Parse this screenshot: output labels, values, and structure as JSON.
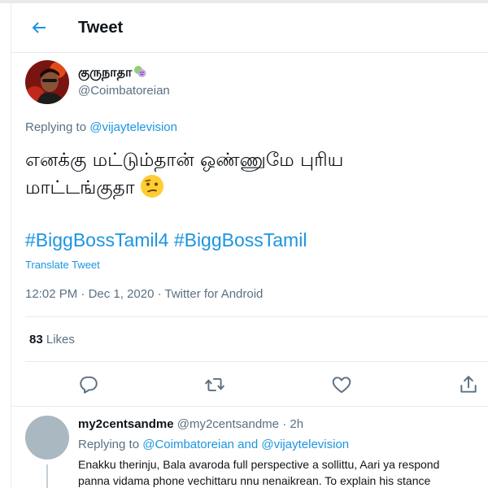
{
  "header": {
    "title": "Tweet"
  },
  "tweet": {
    "author_name": "குருநாதா",
    "author_handle": "@Coimbatoreian",
    "replying_prefix": "Replying to",
    "replying_handle": "@vijaytelevision",
    "text_line1": "எனக்கு மட்டும்தான்  ஒண்ணுமே புரிய",
    "text_line2": "மாட்டங்குதா",
    "hashtags": [
      "#BiggBossTamil4",
      "#BiggBossTamil"
    ],
    "translate_label": "Translate Tweet",
    "time": "12:02 PM",
    "date": "Dec 1, 2020",
    "source": "Twitter for Android",
    "separator": " · ",
    "likes_count": "83",
    "likes_label": "Likes"
  },
  "reply": {
    "name": "my2centsandme",
    "handle": "@my2centsandme",
    "age": "· 2h",
    "replying_prefix": "Replying to",
    "replying_handle1": "@Coimbatoreian",
    "replying_and": "and",
    "replying_handle2": "@vijaytelevision",
    "body_line1": "Enakku therinju, Bala avaroda full perspective a sollittu, Aari ya respond",
    "body_line2": "panna vidama phone vechittaru nnu nenaikrean. To explain his stance"
  },
  "icons": {
    "back": "arrow-left-icon",
    "reply": "comment-icon",
    "retweet": "retweet-icon",
    "like": "heart-icon",
    "share": "share-icon"
  },
  "colors": {
    "accent": "#1b95e0",
    "secondary_text": "#5b7083",
    "primary_text": "#0f1419",
    "divider": "#e6ecf0"
  }
}
